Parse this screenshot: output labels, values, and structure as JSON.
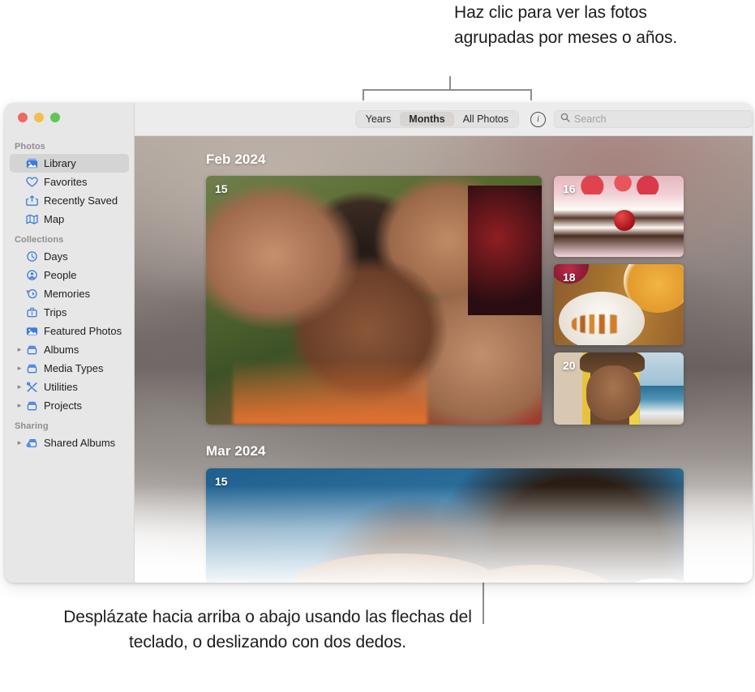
{
  "callouts": {
    "top": "Haz clic para ver las fotos agrupadas por meses o años.",
    "bottom": "Desplázate hacia arriba o abajo usando las flechas del teclado, o deslizando con dos dedos."
  },
  "window": {
    "traffic_lights": {
      "close": "close-button",
      "minimize": "minimize-button",
      "maximize": "maximize-button"
    }
  },
  "sidebar": {
    "groups": [
      {
        "title": "Photos",
        "items": [
          {
            "label": "Library",
            "icon": "library-icon",
            "selected": true,
            "disclosure": false
          },
          {
            "label": "Favorites",
            "icon": "heart-icon",
            "selected": false,
            "disclosure": false
          },
          {
            "label": "Recently Saved",
            "icon": "recently-saved-icon",
            "selected": false,
            "disclosure": false
          },
          {
            "label": "Map",
            "icon": "map-icon",
            "selected": false,
            "disclosure": false
          }
        ]
      },
      {
        "title": "Collections",
        "items": [
          {
            "label": "Days",
            "icon": "clock-icon",
            "selected": false,
            "disclosure": false
          },
          {
            "label": "People",
            "icon": "person-icon",
            "selected": false,
            "disclosure": false
          },
          {
            "label": "Memories",
            "icon": "memories-icon",
            "selected": false,
            "disclosure": false
          },
          {
            "label": "Trips",
            "icon": "suitcase-icon",
            "selected": false,
            "disclosure": false
          },
          {
            "label": "Featured Photos",
            "icon": "photo-icon",
            "selected": false,
            "disclosure": false
          },
          {
            "label": "Albums",
            "icon": "album-icon",
            "selected": false,
            "disclosure": true
          },
          {
            "label": "Media Types",
            "icon": "album-icon",
            "selected": false,
            "disclosure": true
          },
          {
            "label": "Utilities",
            "icon": "tools-icon",
            "selected": false,
            "disclosure": true
          },
          {
            "label": "Projects",
            "icon": "album-icon",
            "selected": false,
            "disclosure": true
          }
        ]
      },
      {
        "title": "Sharing",
        "items": [
          {
            "label": "Shared Albums",
            "icon": "shared-album-icon",
            "selected": false,
            "disclosure": true
          }
        ]
      }
    ]
  },
  "toolbar": {
    "segments": [
      {
        "label": "Years",
        "active": false
      },
      {
        "label": "Months",
        "active": true
      },
      {
        "label": "All Photos",
        "active": false
      }
    ],
    "info_glyph": "i",
    "search_placeholder": "Search"
  },
  "library": {
    "months": [
      {
        "header": "Feb 2024",
        "photos": [
          {
            "day": "15",
            "art": "group-selfie-outdoors"
          },
          {
            "day": "16",
            "art": "strawberry-cake-slice"
          },
          {
            "day": "18",
            "art": "plated-food-carrots-oranges"
          },
          {
            "day": "20",
            "art": "person-yellow-scarf-beach"
          }
        ]
      },
      {
        "header": "Mar 2024",
        "photos": [
          {
            "day": "15",
            "art": "person-blue-background"
          }
        ]
      }
    ]
  },
  "colors": {
    "window_chrome": "#ececec",
    "sidebar_bg": "#e7e7e7",
    "sidebar_selected": "#d4d4d4",
    "accent_blue": "#3b7ce0",
    "traffic_close": "#ec6a5f",
    "traffic_min": "#f4bd4f",
    "traffic_max": "#61c555",
    "callout_line": "#8d8d8d",
    "callout_text": "#1d1d1f"
  }
}
